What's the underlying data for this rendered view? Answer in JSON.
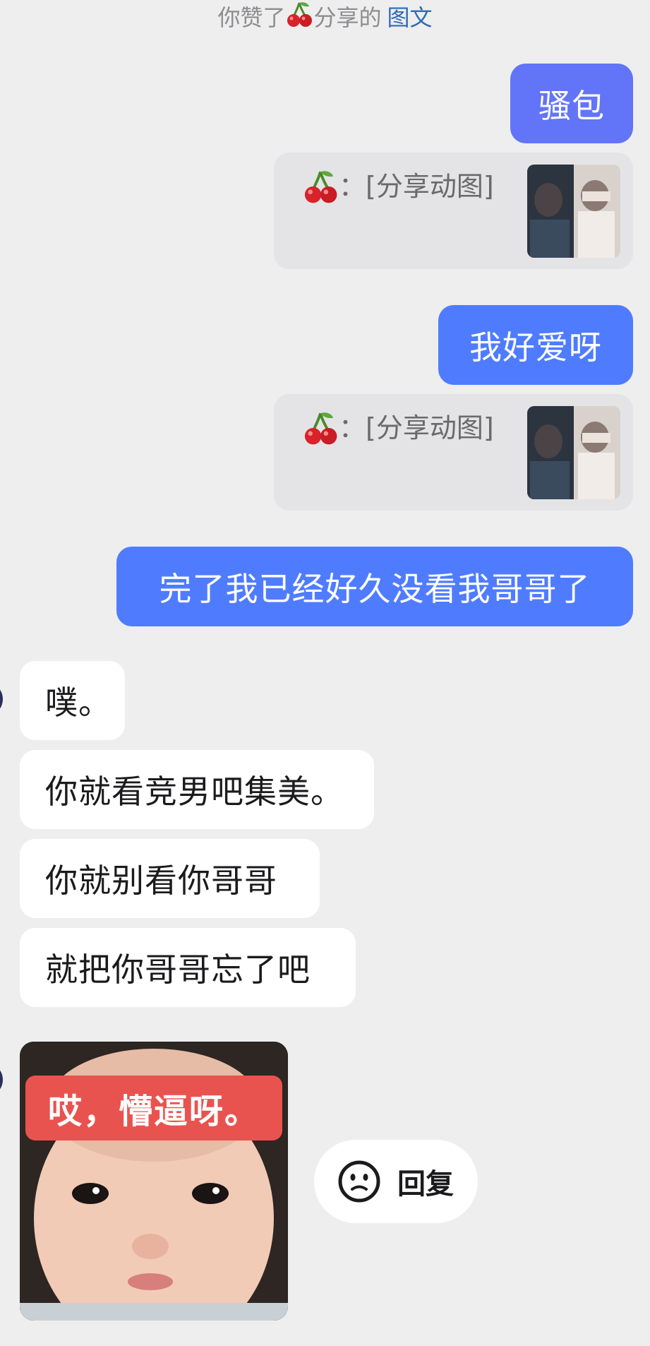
{
  "notice": {
    "prefix": "你赞了",
    "suffix": "分享的",
    "link": "图文"
  },
  "messages_out": [
    {
      "text": "骚包"
    },
    {
      "text": "我好爱呀"
    },
    {
      "text": "完了我已经好久没看我哥哥了"
    }
  ],
  "quotes": [
    {
      "colon": "：",
      "text": "[分享动图]",
      "icon": "cherry-emoji"
    },
    {
      "colon": "：",
      "text": "[分享动图]",
      "icon": "cherry-emoji"
    }
  ],
  "messages_in": [
    {
      "text": "噗。"
    },
    {
      "text": "你就看竞男吧集美。"
    },
    {
      "text": "你就别看你哥哥"
    },
    {
      "text": "就把你哥哥忘了吧"
    }
  ],
  "meme": {
    "caption": "哎，懵逼呀。"
  },
  "reply_button": {
    "icon": "smiley-icon",
    "label": "回复"
  },
  "colors": {
    "background": "#eeeeef",
    "bubble_out": "#4f7cff",
    "bubble_out_first": "#6274f7",
    "bubble_in": "#ffffff",
    "link": "#2f6bb8"
  }
}
